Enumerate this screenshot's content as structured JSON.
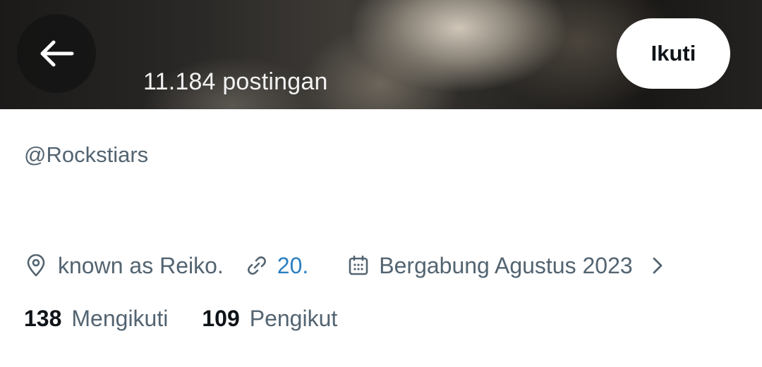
{
  "header": {
    "post_count": "11.184 postingan",
    "follow_label": "Ikuti",
    "back_icon": "arrow-left-icon"
  },
  "profile": {
    "handle": "@Rockstiars",
    "location": "known as Reiko.",
    "link": "20.",
    "joined": "Bergabung Agustus 2023",
    "icons": [
      "location-pin-icon",
      "link-icon",
      "calendar-icon",
      "chevron-right-icon"
    ]
  },
  "stats": {
    "following_count": "138",
    "following_label": "Mengikuti",
    "followers_count": "109",
    "followers_label": "Pengikut"
  },
  "colors": {
    "muted_text": "#536471",
    "link": "#2b7fc0",
    "primary_text": "#0f1419"
  }
}
